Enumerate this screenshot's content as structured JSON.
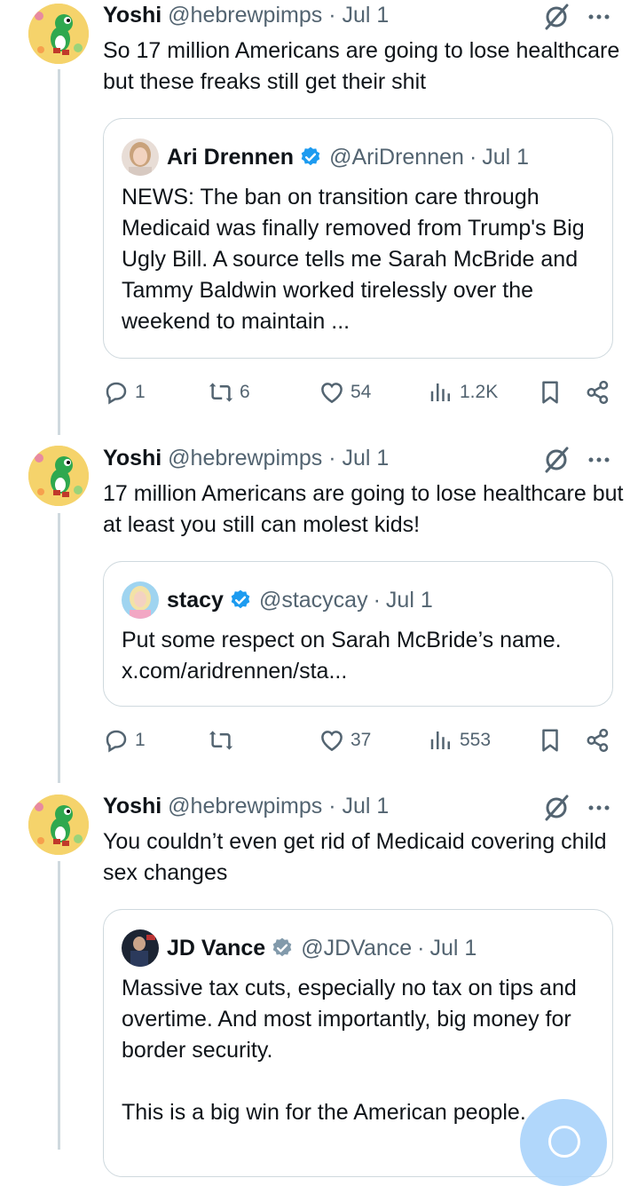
{
  "tweets": [
    {
      "author_name": "Yoshi",
      "author_handle": "@hebrewpimps",
      "date": "Jul 1",
      "text": "So 17 million Americans are going to lose healthcare but these freaks still get their shit",
      "quote": {
        "name": "Ari Drennen",
        "handle": "@AriDrennen",
        "date": "Jul 1",
        "text": "NEWS: The ban on transition care through Medicaid was finally removed from Trump's Big Ugly Bill. A source tells me Sarah McBride and Tammy Baldwin worked tirelessly over the weekend to maintain ..."
      },
      "replies": "1",
      "reposts": "6",
      "likes": "54",
      "views": "1.2K"
    },
    {
      "author_name": "Yoshi",
      "author_handle": "@hebrewpimps",
      "date": "Jul 1",
      "text": "17 million Americans are going to lose healthcare but at least you still can molest kids!",
      "quote": {
        "name": "stacy",
        "handle": "@stacycay",
        "date": "Jul 1",
        "text": "Put some respect on Sarah McBride’s name.\nx.com/aridrennen/sta..."
      },
      "replies": "1",
      "reposts": "",
      "likes": "37",
      "views": "553"
    },
    {
      "author_name": "Yoshi",
      "author_handle": "@hebrewpimps",
      "date": "Jul 1",
      "text": "You couldn’t even get rid of Medicaid covering child sex changes",
      "quote": {
        "name": "JD Vance",
        "handle": "@JDVance",
        "date": "Jul 1",
        "text": "Massive tax cuts, especially no tax on tips and overtime. And most importantly, big money for border security.\n\nThis is a big win for the American people."
      }
    }
  ],
  "separator": "·",
  "colors": {
    "verified_blue": "#1d9bf0",
    "verified_gray": "#829aab",
    "muted": "#536471",
    "border": "#cfd9de"
  },
  "icons": [
    "grok-icon",
    "more-icon",
    "reply-icon",
    "repost-icon",
    "like-icon",
    "views-icon",
    "bookmark-icon",
    "share-icon",
    "verified-badge-icon"
  ]
}
